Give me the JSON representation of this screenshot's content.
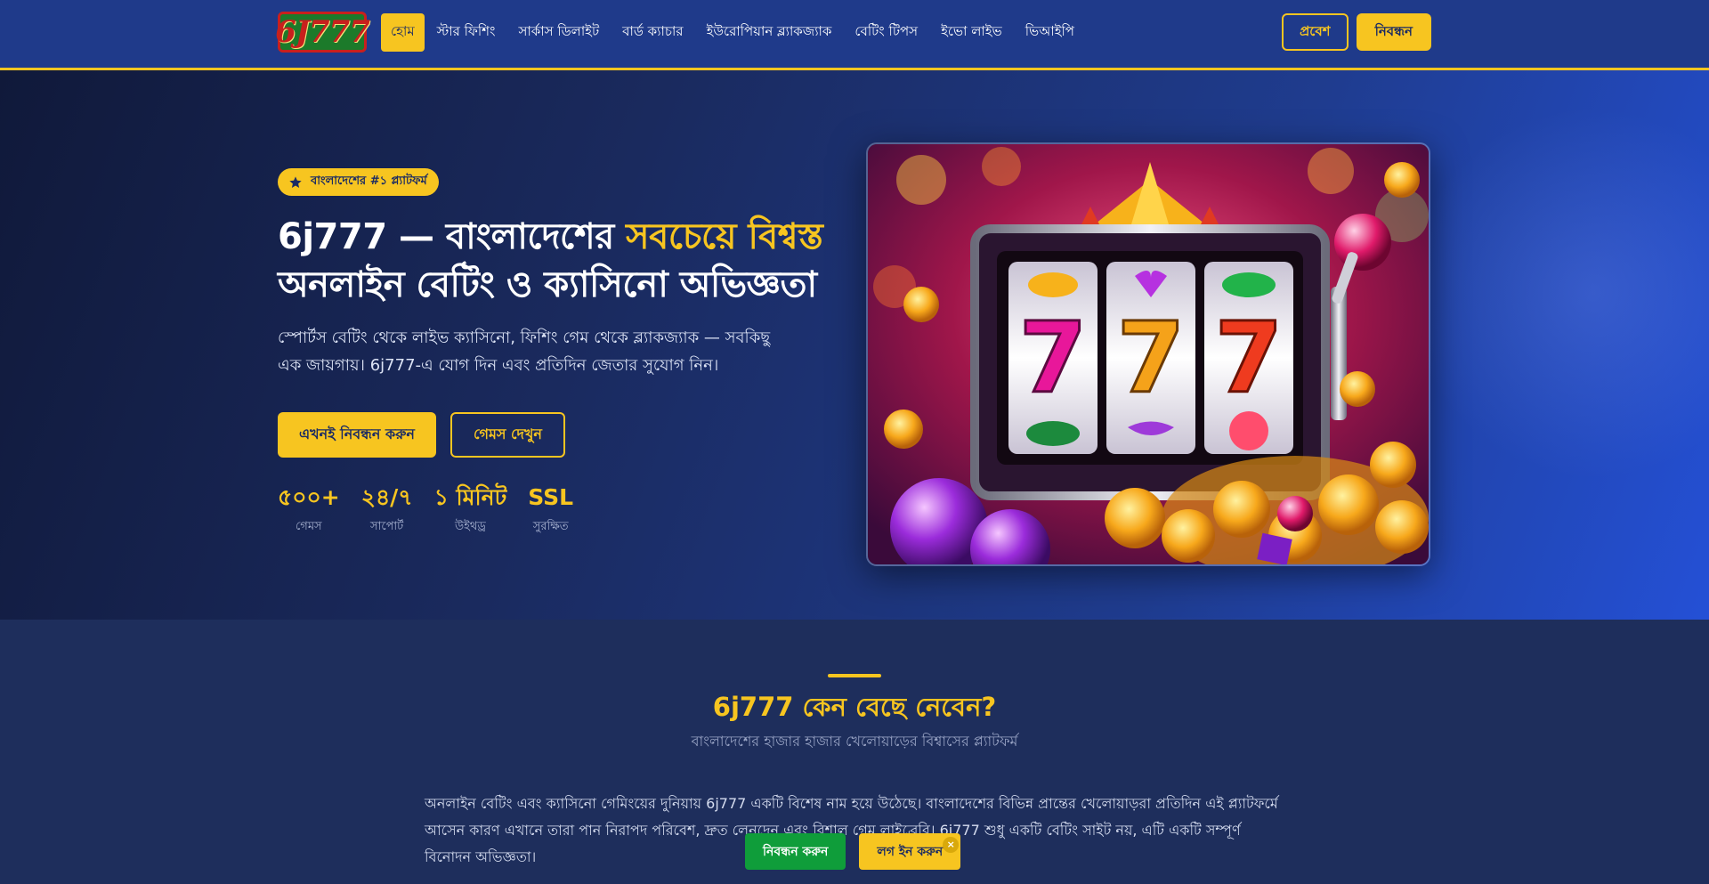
{
  "header": {
    "logo_text": "6J777",
    "nav": [
      {
        "label": "হোম",
        "active": true
      },
      {
        "label": "স্টার ফিশিং"
      },
      {
        "label": "সার্কাস ডিলাইট"
      },
      {
        "label": "বার্ড ক্যাচার"
      },
      {
        "label": "ইউরোপিয়ান ব্ল্যাকজ্যাক"
      },
      {
        "label": "বেটিং টিপস"
      },
      {
        "label": "ইভো লাইভ"
      },
      {
        "label": "ভিআইপি"
      }
    ],
    "login_label": "প্রবেশ",
    "register_label": "নিবন্ধন"
  },
  "hero": {
    "badge": "বাংলাদেশের #১ প্ল্যাটফর্ম",
    "title_part1": "6j777 — বাংলাদেশের ",
    "title_highlight": "সবচেয়ে বিশ্বস্ত",
    "title_part2": "অনলাইন বেটিং ও ক্যাসিনো অভিজ্ঞতা",
    "description": "স্পোর্টস বেটিং থেকে লাইভ ক্যাসিনো, ফিশিং গেম থেকে ব্ল্যাকজ্যাক — সবকিছু এক জায়গায়। 6j777-এ যোগ দিন এবং প্রতিদিন জেতার সুযোগ নিন।",
    "primary_button": "এখনই নিবন্ধন করুন",
    "secondary_button": "গেমস দেখুন",
    "stats": [
      {
        "value": "৫০০+",
        "label": "গেমস"
      },
      {
        "value": "২৪/৭",
        "label": "সাপোর্ট"
      },
      {
        "value": "১ মিনিট",
        "label": "উইথড্র"
      },
      {
        "value": "SSL",
        "label": "সুরক্ষিত"
      }
    ]
  },
  "why": {
    "title": "6j777 কেন বেছে নেবেন?",
    "subtitle": "বাংলাদেশের হাজার হাজার খেলোয়াড়ের বিশ্বাসের প্ল্যাটফর্ম",
    "body": "অনলাইন বেটিং এবং ক্যাসিনো গেমিংয়ের দুনিয়ায় 6j777 একটি বিশেষ নাম হয়ে উঠেছে। বাংলাদেশের বিভিন্ন প্রান্তের খেলোয়াড়রা প্রতিদিন এই প্ল্যাটফর্মে আসেন কারণ এখানে তারা পান নিরাপদ পরিবেশ, দ্রুত লেনদেন এবং বিশাল গেম লাইব্রেরি। 6j777 শুধু একটি বেটিং সাইট নয়, এটি একটি সম্পূর্ণ বিনোদন অভিজ্ঞতা।"
  },
  "sticky": {
    "register": "নিবন্ধন করুন",
    "login": "লগ ইন করুন",
    "close": "×"
  },
  "colors": {
    "accent": "#f7c520",
    "nav_bg": "#1f3a8a",
    "page_bg": "#1e2e5c",
    "sticky_green": "#0f9d3a"
  },
  "icons": {
    "badge": "star-icon",
    "slot": "slot-machine-image"
  }
}
